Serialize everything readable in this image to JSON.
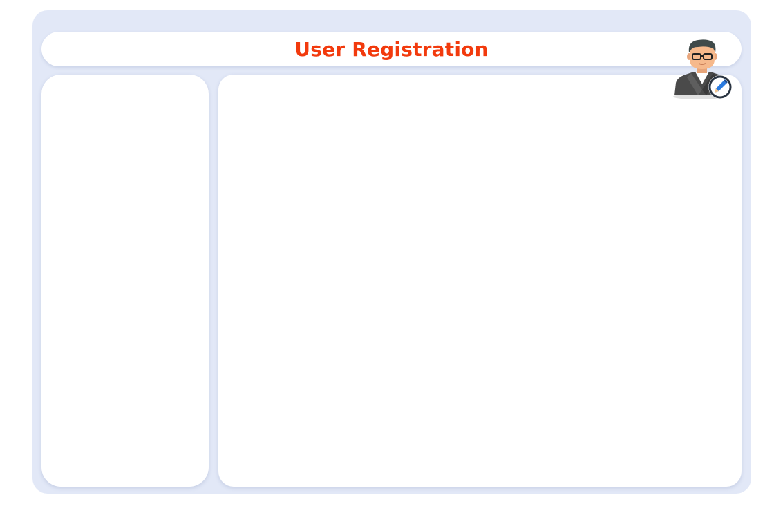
{
  "header": {
    "title": "User Registration",
    "title_color": "#f23a0d"
  },
  "icons": {
    "user_edit": "user-edit-icon",
    "pencil": "pencil-icon"
  },
  "colors": {
    "frame_background": "#e2e8f7",
    "panel_background": "#ffffff"
  }
}
